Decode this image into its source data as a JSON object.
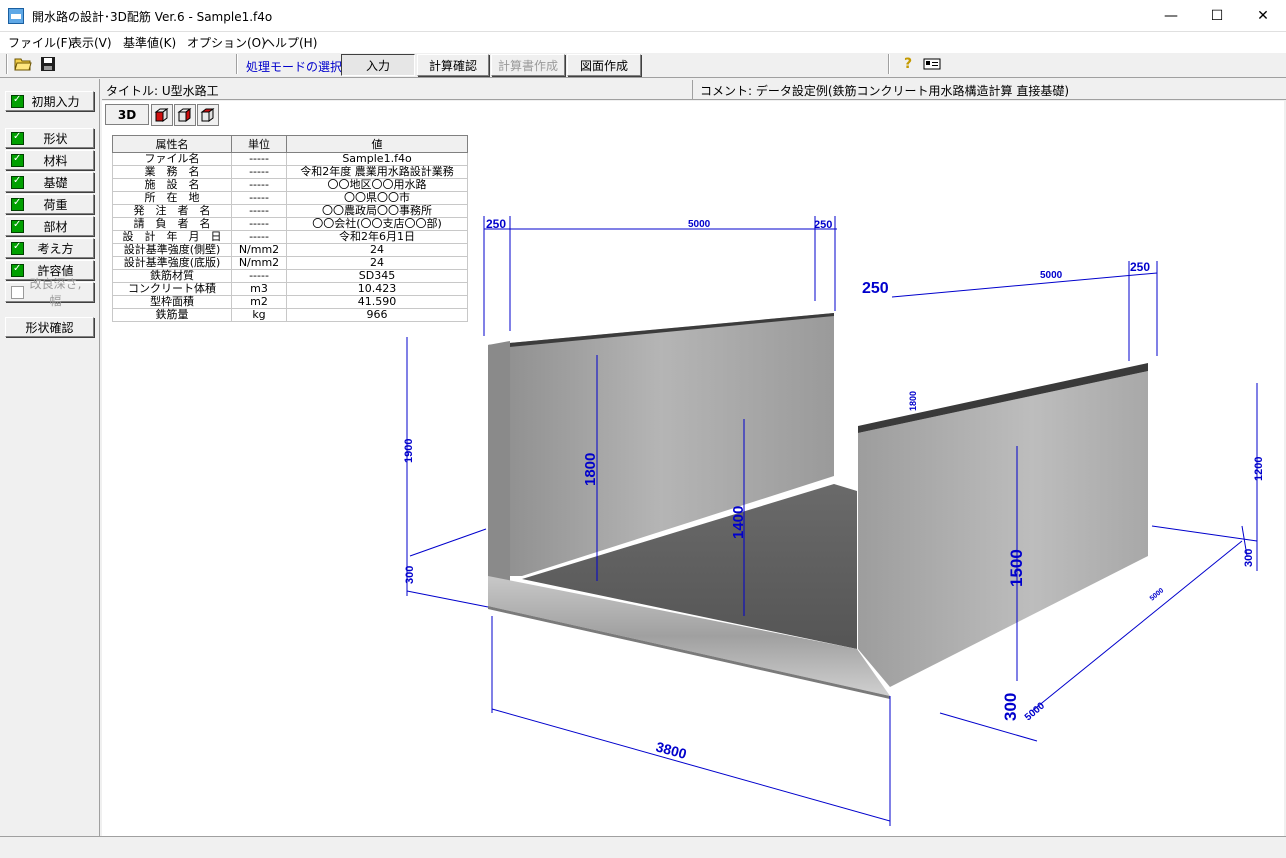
{
  "window": {
    "title": "開水路の設計･3D配筋 Ver.6 - Sample1.f4o",
    "minimize": "—",
    "maximize": "☐",
    "close": "✕"
  },
  "menu": [
    "ファイル(F)",
    "表示(V)",
    "基準値(K)",
    "オプション(O)",
    "ヘルプ(H)"
  ],
  "toolbar": {
    "open_icon": "folder-open-icon",
    "save_icon": "save-icon",
    "mode_label": "処理モードの選択",
    "modes": [
      {
        "label": "入力",
        "state": "active"
      },
      {
        "label": "計算確認",
        "state": "enabled"
      },
      {
        "label": "計算書作成",
        "state": "disabled"
      },
      {
        "label": "図面作成",
        "state": "enabled"
      }
    ],
    "help_icon": "help-icon",
    "info_icon": "id-card-icon"
  },
  "sidebar": {
    "initial": "初期入力",
    "items": [
      "形状",
      "材料",
      "基礎",
      "荷重",
      "部材",
      "考え方",
      "許容値"
    ],
    "disabled_item": "改良深さ,幅",
    "shape_check": "形状確認"
  },
  "header": {
    "title": "タイトル:  U型水路工",
    "comment": "コメント:  データ設定例(鉄筋コンクリート用水路構造計算  直接基礎)"
  },
  "view": {
    "tab_3d": "3D",
    "cube_icons": [
      "cube-front-icon",
      "cube-side-icon",
      "cube-top-icon"
    ]
  },
  "table": {
    "headers": [
      "属性名",
      "単位",
      "値"
    ],
    "rows": [
      [
        "ファイル名",
        "-----",
        "Sample1.f4o"
      ],
      [
        "業　務　名",
        "-----",
        "令和2年度 農業用水路設計業務"
      ],
      [
        "施　設　名",
        "-----",
        "〇〇地区〇〇用水路"
      ],
      [
        "所　在　地",
        "-----",
        "〇〇県〇〇市"
      ],
      [
        "発　注　者　名",
        "-----",
        "〇〇農政局〇〇事務所"
      ],
      [
        "請　負　者　名",
        "-----",
        "〇〇会社(〇〇支店〇〇部)"
      ],
      [
        "設　計　年　月　日",
        "-----",
        "令和2年6月1日"
      ],
      [
        "設計基準強度(側壁)",
        "N/mm2",
        "24"
      ],
      [
        "設計基準強度(底版)",
        "N/mm2",
        "24"
      ],
      [
        "鉄筋材質",
        "-----",
        "SD345"
      ],
      [
        "コンクリート体積",
        "m3",
        "10.423"
      ],
      [
        "型枠面積",
        "m2",
        "41.590"
      ],
      [
        "鉄筋量",
        "kg",
        "966"
      ]
    ]
  },
  "dimensions": {
    "top_left_a": "250",
    "top_len_a": "5000",
    "top_right_a": "250",
    "top_left_b": "250",
    "top_len_b": "5000",
    "top_right_b": "250",
    "h1900": "1900",
    "h1800": "1800",
    "h1400": "1400",
    "h1500": "1500",
    "h1200": "1200",
    "h1800b": "1800",
    "b300a": "300",
    "b300b": "300",
    "b300c": "300",
    "len5000": "5000",
    "width3800": "3800",
    "len_small": "5000"
  }
}
